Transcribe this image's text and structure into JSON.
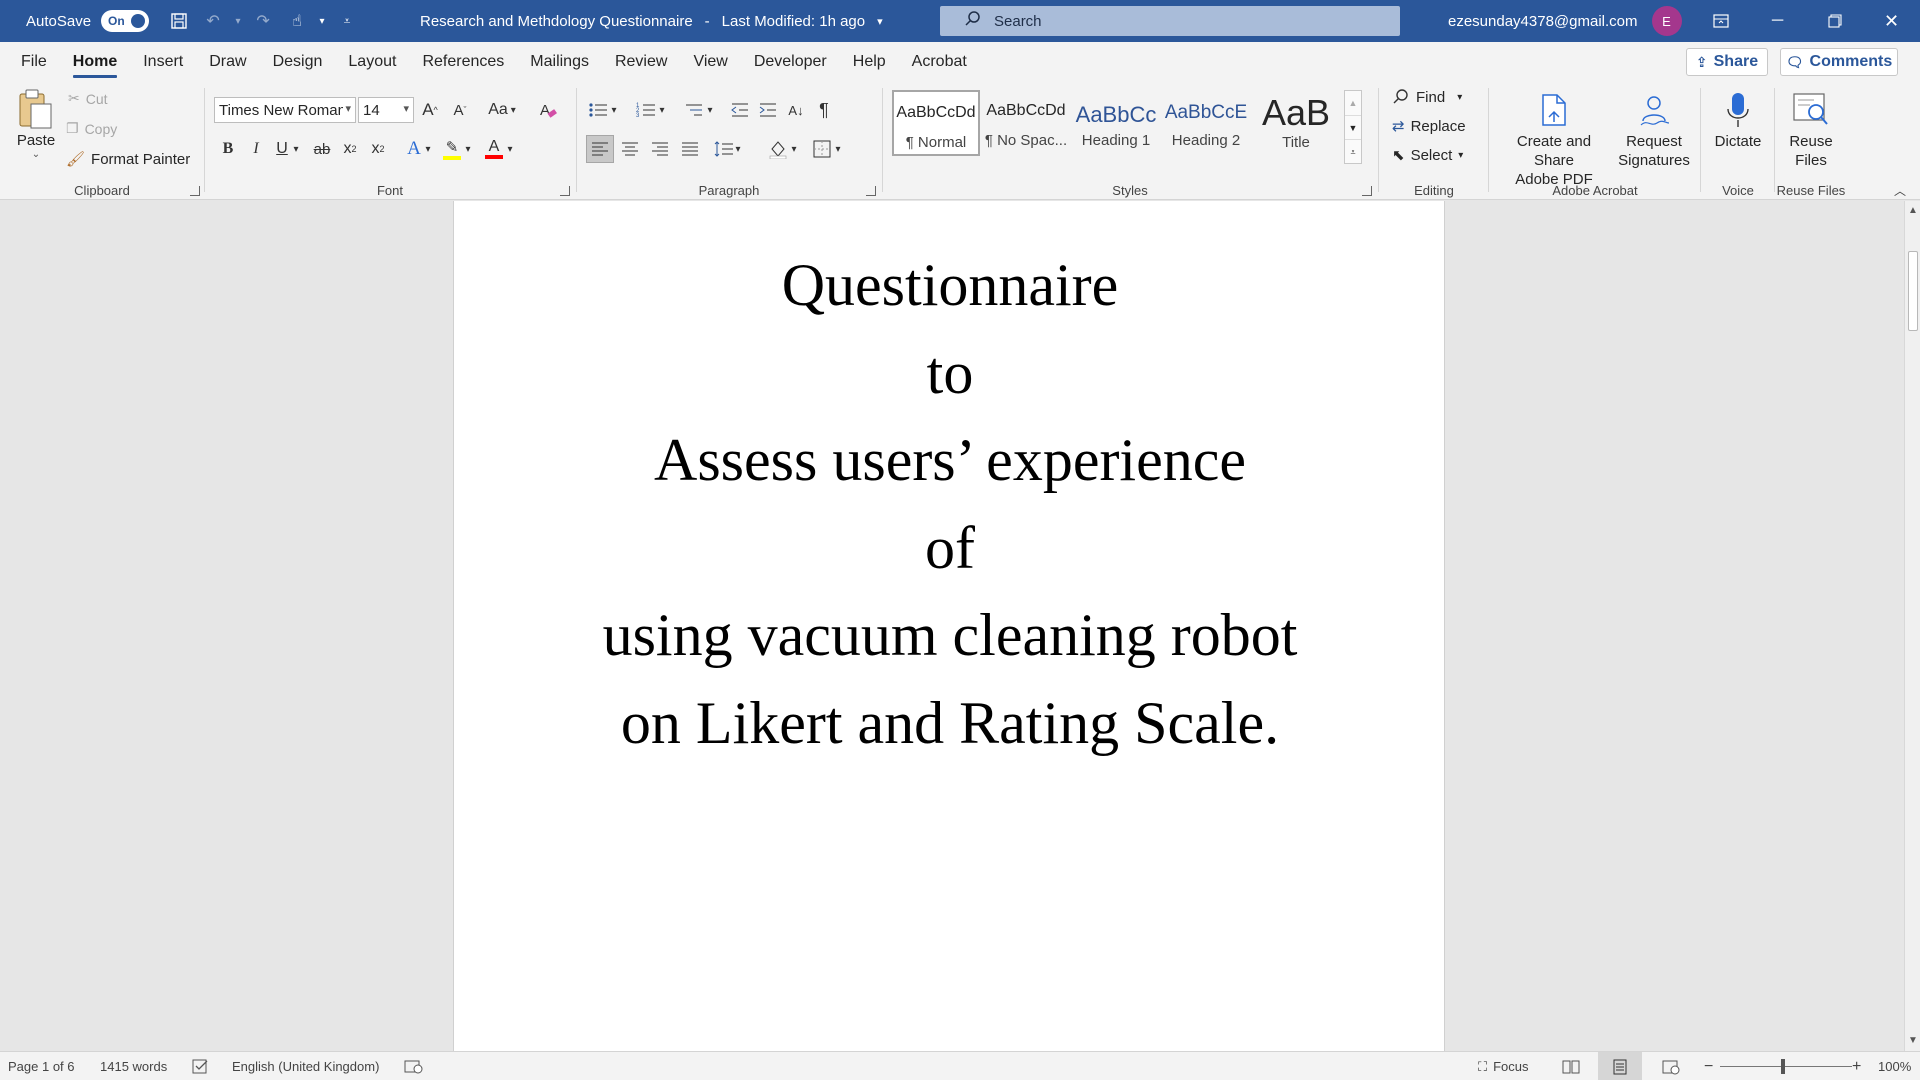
{
  "titlebar": {
    "autosave_label": "AutoSave",
    "autosave_state": "On",
    "document_title": "Research and Methdology Questionnaire",
    "separator": "-",
    "last_modified": "Last Modified: 1h ago",
    "search_placeholder": "Search",
    "account_email": "ezesunday4378@gmail.com",
    "avatar_initial": "E"
  },
  "tabs": [
    "File",
    "Home",
    "Insert",
    "Draw",
    "Design",
    "Layout",
    "References",
    "Mailings",
    "Review",
    "View",
    "Developer",
    "Help",
    "Acrobat"
  ],
  "active_tab": "Home",
  "share": {
    "share_label": "Share",
    "comments_label": "Comments"
  },
  "clipboard": {
    "paste": "Paste",
    "cut": "Cut",
    "copy": "Copy",
    "format_painter": "Format Painter",
    "label": "Clipboard"
  },
  "font": {
    "font_name": "Times New Roman",
    "font_size": "14",
    "grow": "A",
    "shrink": "A",
    "change_case": "Aa",
    "bold": "B",
    "italic": "I",
    "underline": "U",
    "strike": "ab",
    "subscript": "x",
    "superscript": "x",
    "text_effects": "A",
    "font_color": "A",
    "label": "Font"
  },
  "paragraph": {
    "label": "Paragraph"
  },
  "styles": {
    "items": [
      {
        "preview": "AaBbCcDd",
        "name": "¶ Normal"
      },
      {
        "preview": "AaBbCcDd",
        "name": "¶ No Spac..."
      },
      {
        "preview": "AaBbCc",
        "name": "Heading 1"
      },
      {
        "preview": "AaBbCcE",
        "name": "Heading 2"
      },
      {
        "preview": "AaB",
        "name": "Title"
      }
    ],
    "label": "Styles"
  },
  "editing": {
    "find": "Find",
    "replace": "Replace",
    "select": "Select",
    "label": "Editing"
  },
  "acrobat": {
    "create_share_line1": "Create and Share",
    "create_share_line2": "Adobe PDF",
    "request_line1": "Request",
    "request_line2": "Signatures",
    "label": "Adobe Acrobat"
  },
  "voice": {
    "dictate": "Dictate",
    "label": "Voice"
  },
  "reuse": {
    "line1": "Reuse",
    "line2": "Files",
    "label": "Reuse Files"
  },
  "document": {
    "lines": [
      "Questionnaire",
      "to",
      "Assess users’ experience",
      "of",
      "using vacuum cleaning robot",
      "on Likert and Rating Scale."
    ]
  },
  "status": {
    "page": "Page 1 of 6",
    "words": "1415 words",
    "language": "English (United Kingdom)",
    "focus": "Focus",
    "zoom_out": "−",
    "zoom_in": "+",
    "zoom": "100%"
  },
  "colors": {
    "titlebar": "#2b579a",
    "highlight": "#ffff00",
    "font_color": "#ff0000",
    "avatar": "#a4378d"
  }
}
